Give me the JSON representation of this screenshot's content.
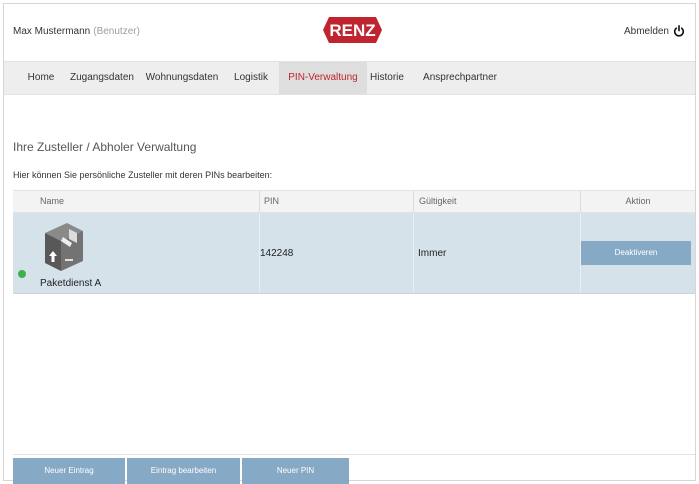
{
  "user": {
    "name": "Max Mustermann",
    "role": "(Benutzer)"
  },
  "brand": {
    "logo_text": "RENZ",
    "logo_color": "#c0252f"
  },
  "logout_label": "Abmelden",
  "nav": {
    "items": [
      {
        "label": "Home"
      },
      {
        "label": "Zugangsdaten"
      },
      {
        "label": "Wohnungsdaten"
      },
      {
        "label": "Logistik"
      },
      {
        "label": "PIN-Verwaltung",
        "active": true
      },
      {
        "label": "Historie"
      },
      {
        "label": "Ansprechpartner"
      }
    ]
  },
  "page": {
    "heading": "Ihre Zusteller / Abholer Verwaltung",
    "subtext": "Hier können Sie persönliche Zusteller mit deren PINs bearbeiten:"
  },
  "table": {
    "columns": [
      "Name",
      "PIN",
      "Gültigkeit",
      "Aktion"
    ],
    "rows": [
      {
        "status": "active",
        "status_color": "#3db04b",
        "icon": "package-icon",
        "name": "Paketdienst A",
        "pin": "142248",
        "validity": "Immer",
        "action_label": "Deaktiveren"
      }
    ]
  },
  "actions": {
    "new_entry": "Neuer Eintrag",
    "edit_entry": "Eintrag bearbeiten",
    "new_pin": "Neuer PIN"
  },
  "colors": {
    "button": "#86a9c5",
    "row_bg": "#d5e2ea",
    "nav_bg": "#eeeeee"
  }
}
